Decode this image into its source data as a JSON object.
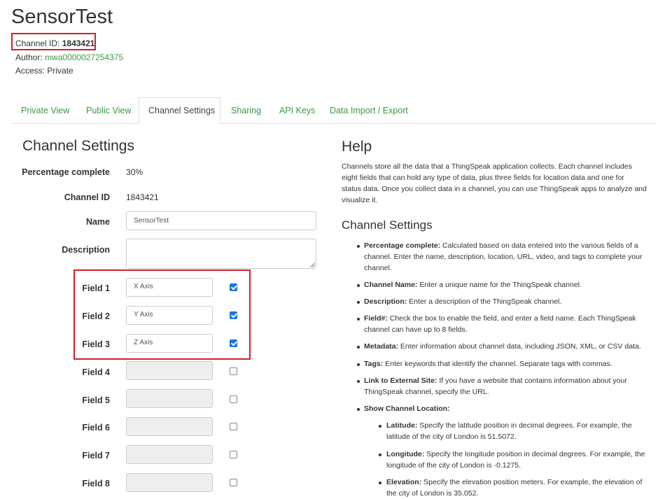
{
  "header": {
    "title": "SensorTest",
    "channel_id_label": "Channel ID:",
    "channel_id_value": "1843421",
    "author_label": "Author:",
    "author_value": "mwa0000027254375",
    "access_label": "Access:",
    "access_value": "Private"
  },
  "tabs": [
    {
      "label": "Private View"
    },
    {
      "label": "Public View"
    },
    {
      "label": "Channel Settings"
    },
    {
      "label": "Sharing"
    },
    {
      "label": "API Keys"
    },
    {
      "label": "Data Import / Export"
    }
  ],
  "settings": {
    "heading": "Channel Settings",
    "percentage_label": "Percentage complete",
    "percentage_value": "30%",
    "channel_id_label": "Channel ID",
    "channel_id_value": "1843421",
    "name_label": "Name",
    "name_value": "SensorTest",
    "description_label": "Description",
    "fields": [
      {
        "label": "Field 1",
        "value": "X Axis",
        "checked": true
      },
      {
        "label": "Field 2",
        "value": "Y Axis",
        "checked": true
      },
      {
        "label": "Field 3",
        "value": "Z Axis",
        "checked": true
      },
      {
        "label": "Field 4",
        "value": "",
        "checked": false
      },
      {
        "label": "Field 5",
        "value": "",
        "checked": false
      },
      {
        "label": "Field 6",
        "value": "",
        "checked": false
      },
      {
        "label": "Field 7",
        "value": "",
        "checked": false
      },
      {
        "label": "Field 8",
        "value": "",
        "checked": false
      }
    ]
  },
  "help": {
    "heading": "Help",
    "intro_1": "Channels store all the data that a ThingSpeak application collects. Each channel includes",
    "intro_2": "eight fields that can hold any type of data, plus three fields for location data and one for",
    "intro_3": "status data. Once you collect data in a channel, you can use ThingSpeak apps to analyze and",
    "intro_4": "visualize it.",
    "subheading": "Channel Settings",
    "items": [
      {
        "term": "Percentage complete:",
        "l1": " Calculated based on data entered into the various fields of a",
        "l2": "channel. Enter the name, description, location, URL, video, and tags to complete your",
        "l3": "channel."
      },
      {
        "term": "Channel Name:",
        "l1": " Enter a unique name for the ThingSpeak channel."
      },
      {
        "term": "Description:",
        "l1": " Enter a description of the ThingSpeak channel."
      },
      {
        "term": "Field#:",
        "l1": " Check the box to enable the field, and enter a field name. Each ThingSpeak",
        "l2": "channel can have up to 8 fields."
      },
      {
        "term": "Metadata:",
        "l1": " Enter information about channel data, including JSON, XML, or CSV data."
      },
      {
        "term": "Tags:",
        "l1": " Enter keywords that identify the channel. Separate tags with commas."
      },
      {
        "term": "Link to External Site:",
        "l1": " If you have a website that contains information about your",
        "l2": "ThingSpeak channel, specify the URL."
      },
      {
        "term": "Show Channel Location:"
      }
    ],
    "subitems": [
      {
        "term": "Latitude:",
        "l1": " Specify the latitude position in decimal degrees. For example, the",
        "l2": "latitude of the city of London is 51.5072."
      },
      {
        "term": "Longitude:",
        "l1": " Specify the longitude position in decimal degrees. For example, the",
        "l2": "longitude of the city of London is -0.1275."
      },
      {
        "term": "Elevation:",
        "l1": " Specify the elevation position meters. For example, the elevation of",
        "l2": "the city of London is 35.052."
      }
    ]
  }
}
